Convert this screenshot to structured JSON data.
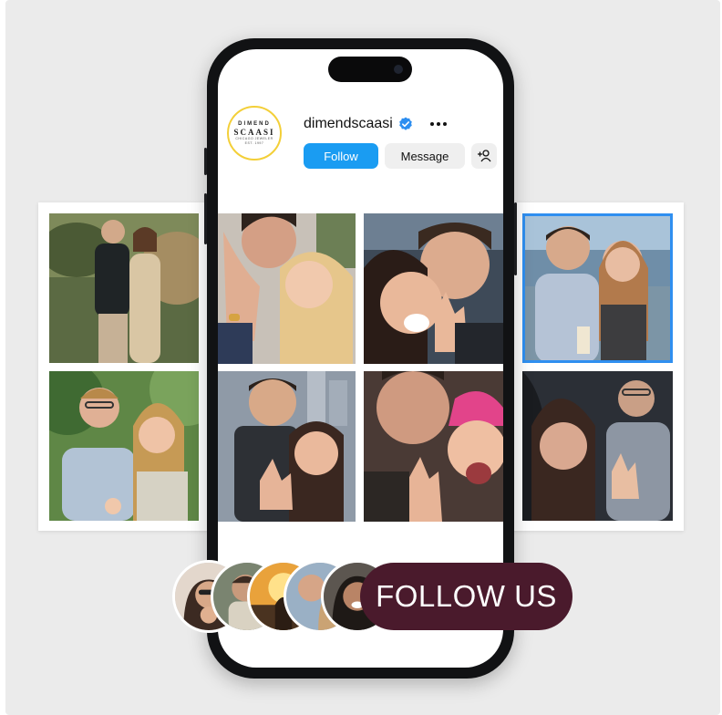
{
  "profile": {
    "username": "dimendscaasi",
    "logo": {
      "top": "DIMEND",
      "main": "SCAASI",
      "sub": "CHICAGO JEWELER",
      "sub2": "EST. 1997"
    },
    "verified": true
  },
  "buttons": {
    "follow": "Follow",
    "message": "Message"
  },
  "icons": {
    "verified": "verified-badge-icon",
    "more": "more-options-icon",
    "add_user": "add-user-icon"
  },
  "cta": {
    "label": "FOLLOW US"
  },
  "colors": {
    "follow_button": "#1a9cf2",
    "cta_background": "#4a1a2c",
    "logo_ring": "#f3cf38",
    "selected_outline": "#2f8ff0",
    "background": "#ebebeb"
  },
  "photos": [
    {
      "name": "couple-outdoor-garden",
      "selected": false
    },
    {
      "name": "couple-kiss-ring",
      "selected": false
    },
    {
      "name": "couple-selfie-ring",
      "selected": false
    },
    {
      "name": "couple-lake-view",
      "selected": true
    },
    {
      "name": "couple-trees-ring",
      "selected": false
    },
    {
      "name": "couple-city-ring",
      "selected": false
    },
    {
      "name": "couple-pink-cap",
      "selected": false
    },
    {
      "name": "couple-car-selfie",
      "selected": false
    }
  ],
  "follower_avatars": [
    "avatar-1",
    "avatar-2",
    "avatar-3",
    "avatar-4",
    "avatar-5"
  ]
}
